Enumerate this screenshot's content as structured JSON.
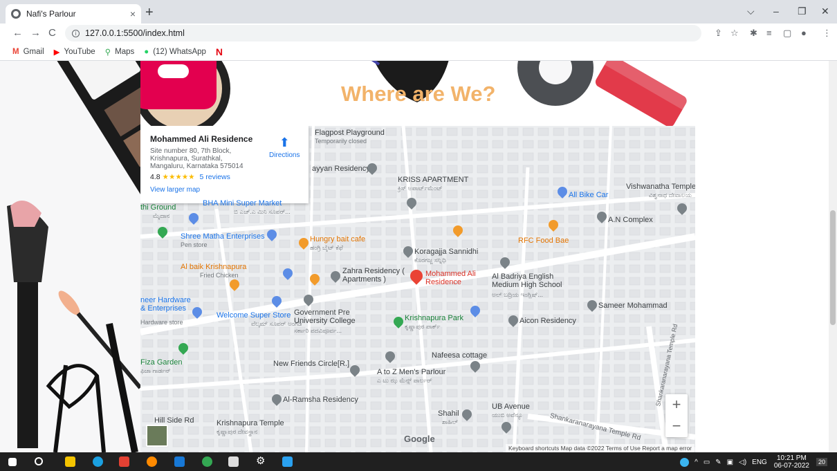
{
  "browser": {
    "tab_title": "Nafi's Parlour",
    "tab_close": "×",
    "new_tab": "+",
    "url": "127.0.0.1:5500/index.html",
    "window_controls": {
      "collapse": "⌵",
      "minimize": "–",
      "restore": "❐",
      "close": "✕"
    }
  },
  "bookmarks": [
    {
      "label": "Gmail",
      "icon": "gmail-icon",
      "color": "#ea4335",
      "glyph": "M"
    },
    {
      "label": "YouTube",
      "icon": "youtube-icon",
      "color": "#ff0000",
      "glyph": "▶"
    },
    {
      "label": "Maps",
      "icon": "maps-icon",
      "color": "#34a853",
      "glyph": "⚲"
    },
    {
      "label": "(12) WhatsApp",
      "icon": "whatsapp-icon",
      "color": "#25d366",
      "glyph": "●"
    },
    {
      "label": "",
      "icon": "netflix-icon",
      "color": "#e50914",
      "glyph": "N"
    }
  ],
  "page": {
    "heading": "Where are We?",
    "heading_color": "#f2b36a"
  },
  "map": {
    "info_card": {
      "name": "Mohammed Ali Residence",
      "address": "Site number 80, 7th Block, Krishnapura, Surathkal, Mangaluru, Karnataka 575014",
      "rating": "4.8",
      "stars": "★★★★★",
      "reviews": "5 reviews",
      "view_larger": "View larger map",
      "directions": "Directions"
    },
    "labels": {
      "flagpost": "Flagpost Playground",
      "flagpost_sub": "Temporarily closed",
      "ayyan": "ayyan Residency",
      "kriss": "KRISS APARTMENT",
      "kriss_sub": "ಕ್ರಿಸ್ ಅಪಾರ್ಟ್‌ಮೆಂಟ್",
      "vishwanatha": "Vishwanatha Temple",
      "vishwanatha_sub": "ವಿಶ್ವನಾಥ ದೇವಾಲಯ",
      "ali_bike": "All Bike Car",
      "an_complex": "A.N Complex",
      "ground": "thi Ground",
      "ground_sub": "ಮೈದಾನ",
      "bha": "BHA Mini Super Market",
      "bha_sub": "ಬಿ ಎಚ್.ಎ ಮಿನಿ ಸೂಪರ್...",
      "shree": "Shree Matha Enterprises",
      "shree_sub": "Pen store",
      "hungry": "Hungry bait cafe",
      "hungry_sub": "ಹಂಗ್ರಿ ಬೈಟ್ ಕೆಫೆ",
      "koragajja": "Koragajja Sannidhi",
      "koragajja_sub": "ಕೊರಗಜ್ಜ ಸನ್ನಿಧಿ",
      "rfc": "RFC Food Bae",
      "albaik": "Al baik Krishnapura",
      "albaik_sub": "Fried Chicken",
      "zahra": "Zahra Residency ( Apartments )",
      "mohammed": "Mohammed Ali Residence",
      "badriya": "Al Badriya English Medium High School",
      "badriya_sub": "ಅಲ್ ಬದ್ರಿಯ ಇಂಗ್ಲಿಷ್...",
      "hardware": "neer Hardware & Enterprises",
      "hardware_sub": "Hardware store",
      "welcome": "Welcome Super Store",
      "welcome_sub": "ವೆಲ್ಕಮ್ ಸೂಪರ್ ಅಂಗಡಿ",
      "govt": "Government Pre University College",
      "govt_sub": "ಸರ್ಕಾರಿ ಪದವಿಪೂರ್ವ...",
      "krishnapura_park": "Krishnapura Park",
      "krishnapura_park_sub": "ಕೃಷ್ಣಾಪುರ ಪಾರ್ಕ್",
      "sameer": "Sameer Mohammad",
      "aicon": "Aicon Residency",
      "fiza": "Fiza Garden",
      "fiza_sub": "ಫಿಜಾ ಗಾರ್ಡನ್",
      "new_friends": "New Friends Circle[R.]",
      "nafeesa": "Nafeesa cottage",
      "atoz": "A to Z Men's Parlour",
      "atoz_sub": "ಎ ಟು ಝ ಮೆನ್ಸ್ ಪಾರ್ಲರ್",
      "alramsha": "Al-Ramsha Residency",
      "hillside": "Hill Side Rd",
      "krishnapura_temple": "Krishnapura Temple",
      "krishnapura_temple_sub": "ಕೃಷ್ಣಾಪುರ ದೇವಸ್ಥಾನ",
      "shahil": "Shahil",
      "shahil_sub": "ಶಾಹಿಲ್",
      "ub_avenue": "UB Avenue",
      "ub_avenue_sub": "ಯುಬಿ ಅವೆನ್ಯೂ",
      "shankar_rd": "Shankaranarayana Temple Rd",
      "shankar_rd2": "Shankaranarayana Temple Rd"
    },
    "zoom_in": "+",
    "zoom_out": "−",
    "google": "Google",
    "footer": "Keyboard shortcuts   Map data ©2022   Terms of Use   Report a map error"
  },
  "taskbar": {
    "lang": "ENG",
    "time": "10:21 PM",
    "date": "06-07-2022",
    "notif": "20"
  }
}
